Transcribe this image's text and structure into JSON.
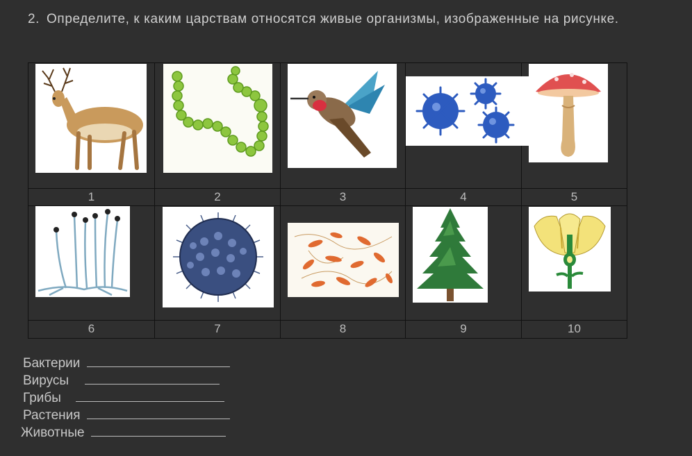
{
  "question": {
    "number": "2.",
    "text": "Определите, к каким царствам относятся живые организмы, изображенные на рисунке."
  },
  "pictures": [
    {
      "label": "1",
      "depicts": "deer-icon"
    },
    {
      "label": "2",
      "depicts": "cyanobacteria-chain-icon"
    },
    {
      "label": "3",
      "depicts": "hummingbird-icon"
    },
    {
      "label": "4",
      "depicts": "virus-icon"
    },
    {
      "label": "5",
      "depicts": "mushroom-icon"
    },
    {
      "label": "6",
      "depicts": "mold-fungus-icon"
    },
    {
      "label": "7",
      "depicts": "virus-particle-icon"
    },
    {
      "label": "8",
      "depicts": "bacteria-icon"
    },
    {
      "label": "9",
      "depicts": "spruce-tree-icon"
    },
    {
      "label": "10",
      "depicts": "flower-icon"
    }
  ],
  "answers": [
    {
      "label": "Бактерии"
    },
    {
      "label": "Вирусы"
    },
    {
      "label": "Грибы"
    },
    {
      "label": "Растения"
    },
    {
      "label": "Животные"
    }
  ],
  "colors": {
    "background": "#2f2f2f",
    "text": "#c8c8c8",
    "grid_line": "#111111"
  }
}
